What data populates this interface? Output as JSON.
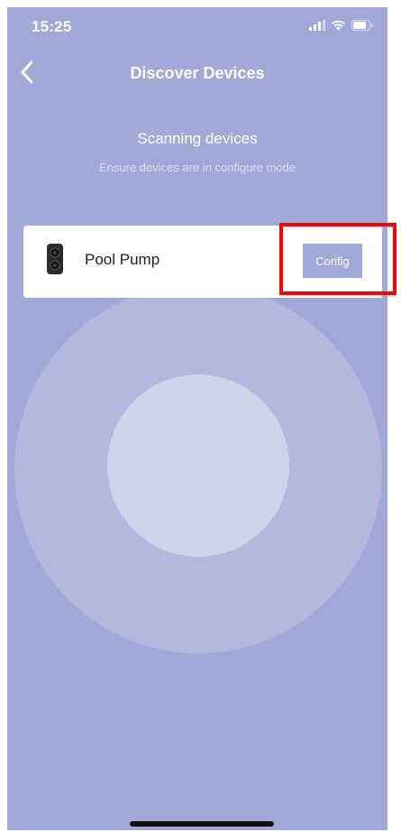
{
  "status_bar": {
    "time": "15:25",
    "icons": [
      "cellular-signal-icon",
      "wifi-icon",
      "battery-icon"
    ]
  },
  "nav": {
    "back_icon": "chevron-left-icon",
    "title": "Discover Devices"
  },
  "scan": {
    "title": "Scanning devices",
    "subtitle": "Ensure devices are in configure mode"
  },
  "device": {
    "icon": "pool-pump-icon",
    "name": "Pool Pump",
    "config_label": "Config"
  },
  "colors": {
    "background": "#a1a9d9",
    "radar_outer": "#b3b8de",
    "radar_inner": "#cfd3ea",
    "button": "#a1a9d9",
    "highlight": "#ff0000"
  }
}
